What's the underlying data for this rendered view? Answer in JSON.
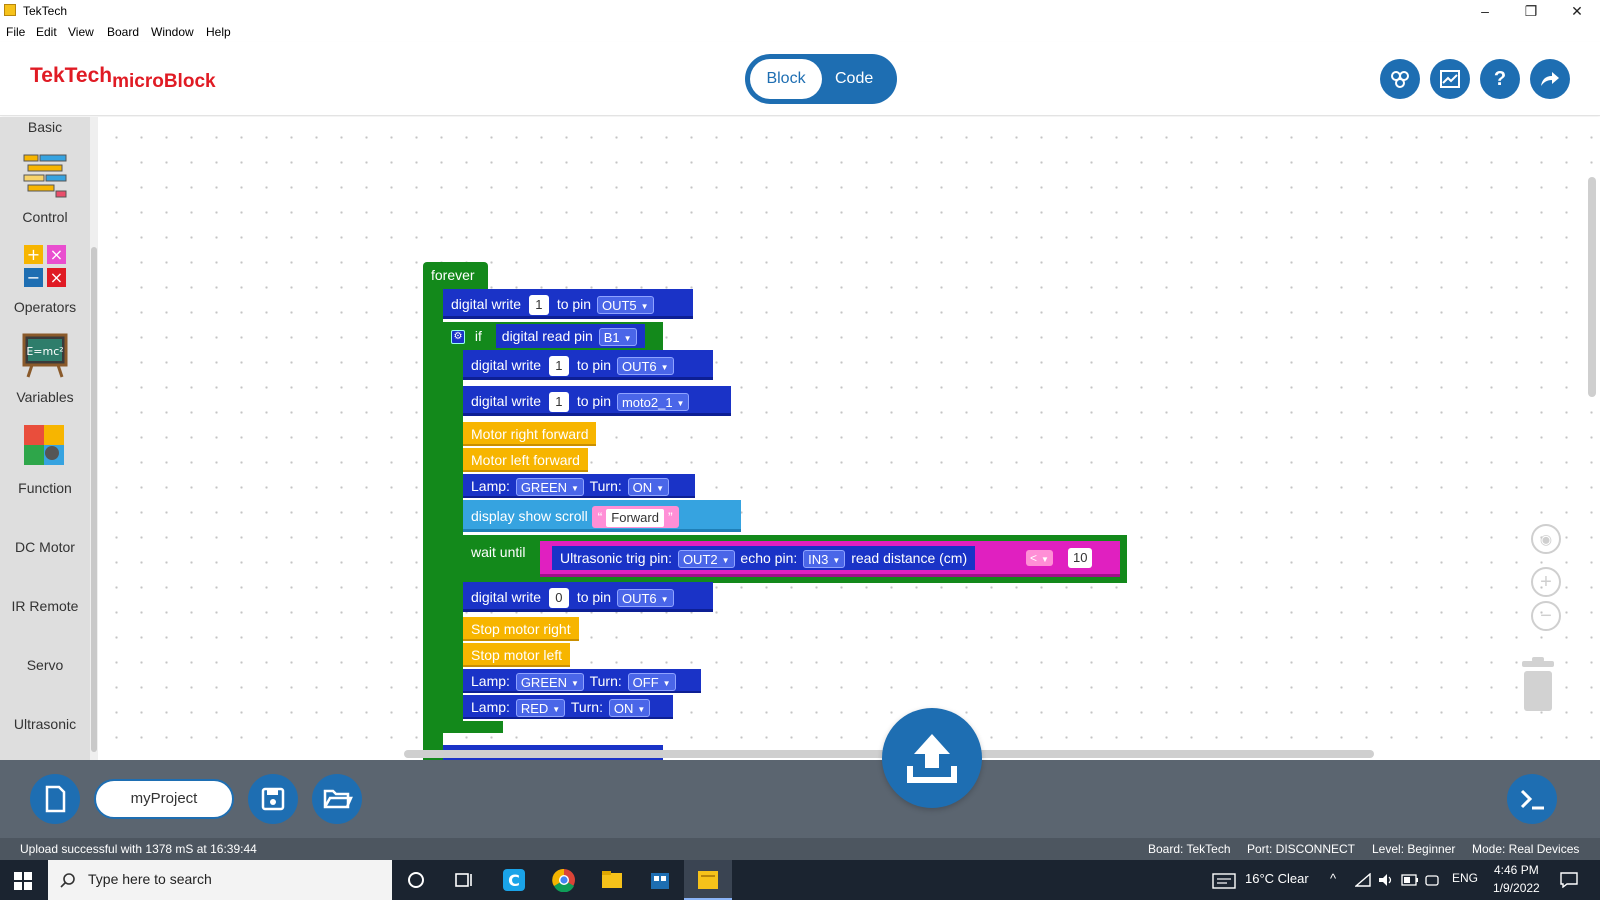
{
  "window": {
    "title": "TekTech",
    "minimize": "–",
    "maximize": "❐",
    "close": "✕"
  },
  "menu": [
    "File",
    "Edit",
    "View",
    "Board",
    "Window",
    "Help"
  ],
  "header": {
    "logo_main": "TekTech",
    "logo_sub": "microBlock",
    "mode_block": "Block",
    "mode_code": "Code"
  },
  "sidebar": {
    "categories": [
      "Basic",
      "Control",
      "Operators",
      "Variables",
      "Function",
      "DC Motor",
      "IR Remote",
      "Servo",
      "Ultrasonic"
    ]
  },
  "blocks": {
    "forever": "forever",
    "digital_write": "digital write",
    "to_pin": "to pin",
    "if": "if",
    "digital_read_pin": "digital read pin",
    "write1_value": "1",
    "write1_pin": "OUT5",
    "if_pin": "B1",
    "write2_value": "1",
    "write2_pin": "OUT6",
    "write3_value": "1",
    "write3_pin": "moto2_1",
    "motor_right_forward": "Motor right forward",
    "motor_left_forward": "Motor left forward",
    "lamp": "Lamp:",
    "turn": "Turn:",
    "lamp1_color": "GREEN",
    "lamp1_state": "ON",
    "display_show_scroll": "display show scroll",
    "quote_open": "“",
    "quote_close": "”",
    "scroll_text": "Forward",
    "wait_until": "wait until",
    "ultrasonic_trig": "Ultrasonic trig pin:",
    "trig_pin": "OUT2",
    "echo_pin_label": "echo pin:",
    "echo_pin": "IN3",
    "read_distance": "read distance (cm)",
    "compare_op": "<",
    "compare_value": "10",
    "write4_value": "0",
    "write4_pin": "OUT6",
    "stop_motor_right": "Stop motor right",
    "stop_motor_left": "Stop motor left",
    "lamp2_color": "GREEN",
    "lamp2_state": "OFF",
    "lamp3_color": "RED",
    "lamp3_state": "ON"
  },
  "bottom": {
    "project_name": "myProject",
    "upload_status": "Upload successful with 1378 mS at 16:39:44",
    "board": "Board: TekTech",
    "port": "Port: DISCONNECT",
    "level": "Level: Beginner",
    "mode": "Mode: Real Devices"
  },
  "taskbar": {
    "search_placeholder": "Type here to search",
    "weather": "16°C  Clear",
    "lang": "ENG",
    "time": "4:46 PM",
    "date": "1/9/2022"
  },
  "colors": {
    "brand_blue": "#1e6eb2",
    "logo_red": "#e01b24",
    "block_green": "#13891b",
    "block_blue": "#1a33c7",
    "block_yellow": "#f7b500"
  }
}
